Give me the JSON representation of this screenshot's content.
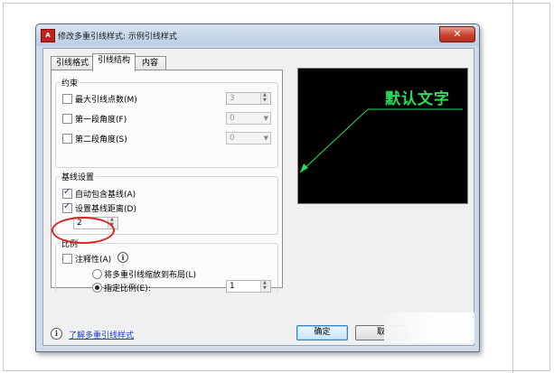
{
  "window": {
    "title": "修改多重引线样式: 示例引线样式",
    "icon_text": "A",
    "close_glyph": "✕"
  },
  "tabs": [
    {
      "label": "引线格式",
      "active": false
    },
    {
      "label": "引线结构",
      "active": true
    },
    {
      "label": "内容",
      "active": false
    }
  ],
  "constraints": {
    "title": "约束",
    "max_points": {
      "label": "最大引线点数(M)",
      "checked": false,
      "value": "3"
    },
    "first_angle": {
      "label": "第一段角度(F)",
      "checked": false,
      "value": "0"
    },
    "second_angle": {
      "label": "第二段角度(S)",
      "checked": false,
      "value": "0"
    }
  },
  "landing": {
    "title": "基线设置",
    "auto_include": {
      "label": "自动包含基线(A)",
      "checked": true
    },
    "set_distance": {
      "label": "设置基线距离(D)",
      "checked": true
    },
    "distance_value": "2"
  },
  "scale": {
    "title": "比例",
    "annotative": {
      "label": "注释性(A)",
      "checked": false
    },
    "scale_to_layout": {
      "label": "将多重引线缩放到布局(L)",
      "selected": false
    },
    "specify_scale": {
      "label": "指定比例(E):",
      "selected": true,
      "value": "1"
    },
    "info_glyph": "i"
  },
  "preview": {
    "text": "默认文字",
    "text_color": "#26e05c",
    "leader_color": "#26e05c"
  },
  "footer": {
    "info_glyph": "i",
    "help_link": "了解多重引线样式",
    "ok_label": "确定",
    "cancel_label": "取"
  }
}
